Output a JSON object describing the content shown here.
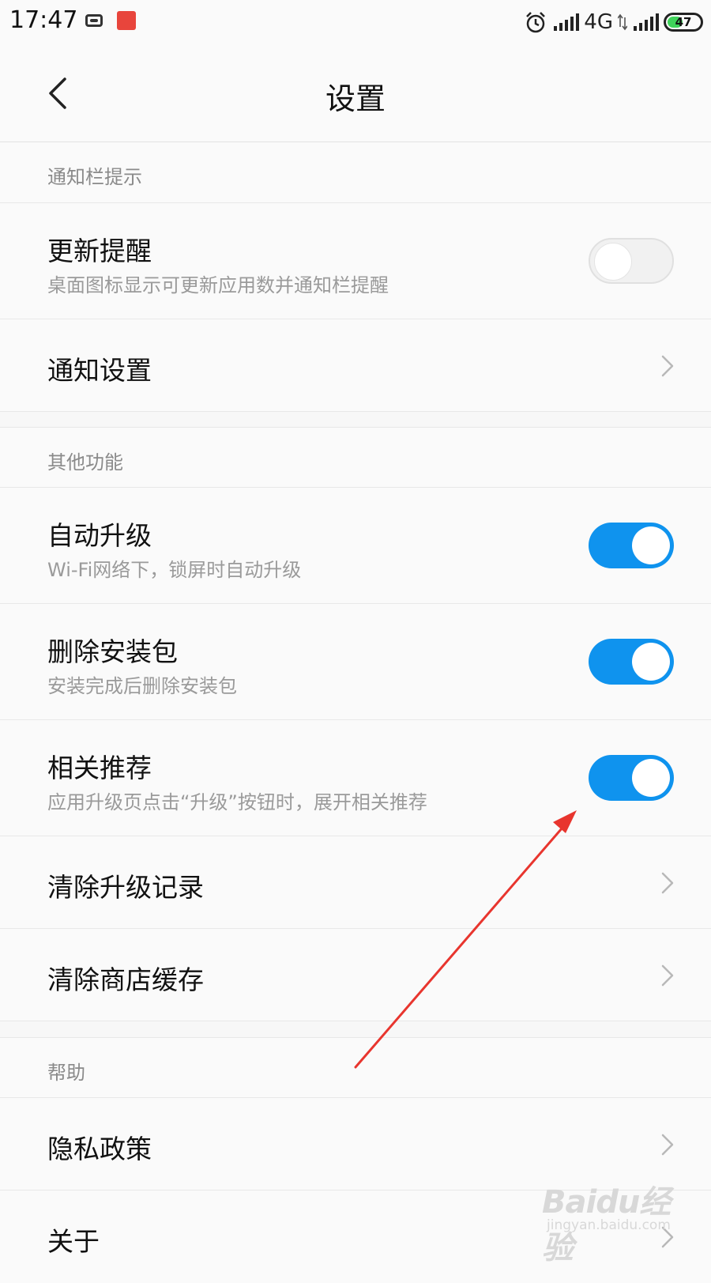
{
  "status_bar": {
    "time": "17:47",
    "network_label": "4G",
    "battery_level": "47",
    "battery_fraction": 0.47
  },
  "header": {
    "title": "设置"
  },
  "sections": {
    "notifications": {
      "header": "通知栏提示",
      "update_reminder": {
        "title": "更新提醒",
        "subtitle": "桌面图标显示可更新应用数并通知栏提醒",
        "enabled": false
      },
      "notification_settings": {
        "title": "通知设置"
      }
    },
    "other": {
      "header": "其他功能",
      "auto_upgrade": {
        "title": "自动升级",
        "subtitle": "Wi-Fi网络下，锁屏时自动升级",
        "enabled": true
      },
      "delete_package": {
        "title": "删除安装包",
        "subtitle": "安装完成后删除安装包",
        "enabled": true
      },
      "related_recommend": {
        "title": "相关推荐",
        "subtitle": "应用升级页点击“升级”按钮时，展开相关推荐",
        "enabled": true
      },
      "clear_upgrade_records": {
        "title": "清除升级记录"
      },
      "clear_store_cache": {
        "title": "清除商店缓存"
      }
    },
    "help": {
      "header": "帮助",
      "privacy_policy": {
        "title": "隐私政策"
      },
      "about": {
        "title": "关于"
      }
    }
  },
  "colors": {
    "accent": "#0f93ee",
    "annotation_arrow": "#e8352e"
  },
  "watermark": {
    "text": "Baidu经验",
    "url": "jingyan.baidu.com"
  }
}
